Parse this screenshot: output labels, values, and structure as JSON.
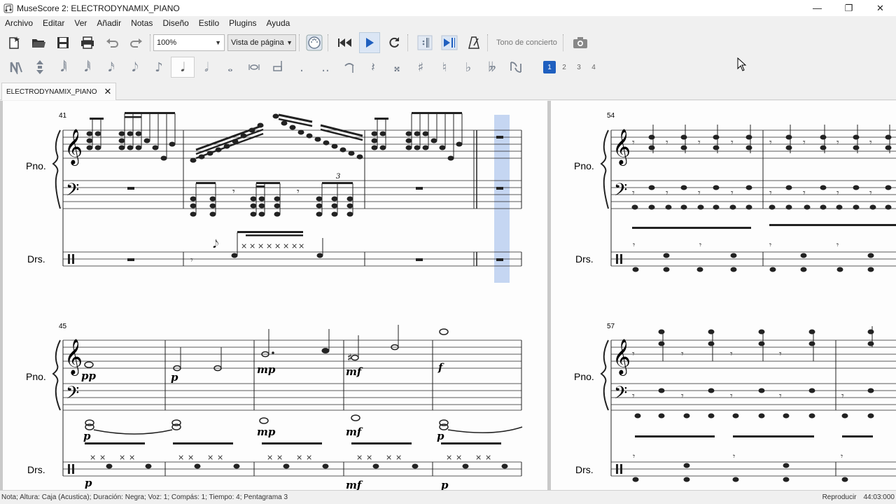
{
  "window": {
    "title": "MuseScore 2: ELECTRODYNAMIX_PIANO",
    "minimize_glyph": "—",
    "maximize_glyph": "❐",
    "close_glyph": "✕"
  },
  "menu": [
    {
      "label": "Archivo"
    },
    {
      "label": "Editar"
    },
    {
      "label": "Ver"
    },
    {
      "label": "Añadir"
    },
    {
      "label": "Notas"
    },
    {
      "label": "Diseño"
    },
    {
      "label": "Estilo"
    },
    {
      "label": "Plugins"
    },
    {
      "label": "Ayuda"
    }
  ],
  "toolbar": {
    "zoom_value": "100%",
    "view_mode": "Vista de página",
    "concert_pitch_label": "Tono de concierto"
  },
  "note_input": {
    "voices": [
      "1",
      "2",
      "3",
      "4"
    ],
    "active_voice": "1"
  },
  "tabs": [
    {
      "label": "ELECTRODYNAMIX_PIANO",
      "close": "✕"
    }
  ],
  "score": {
    "instruments": {
      "piano": "Pno.",
      "drums": "Drs."
    },
    "measure_numbers": {
      "sys1_left": "41",
      "sys2_left": "45",
      "sys1_right": "54",
      "sys2_right": "57"
    },
    "dynamics": {
      "pp": "pp",
      "p": "p",
      "mp": "mp",
      "mf": "mf",
      "f": "f"
    },
    "tuplet": "3"
  },
  "status": {
    "message": "Nota; Altura: Caja (Acustica); Duración: Negra; Voz: 1;  Compás: 1; Tiempo: 4; Pentagrama 3",
    "mode": "Reproducir",
    "time": "44:03:000"
  },
  "colors": {
    "accent": "#1f5fbf",
    "selection": "#c5d6f2",
    "page_bg": "#fdfdfd",
    "canvas_bg": "#c9c9c9"
  }
}
